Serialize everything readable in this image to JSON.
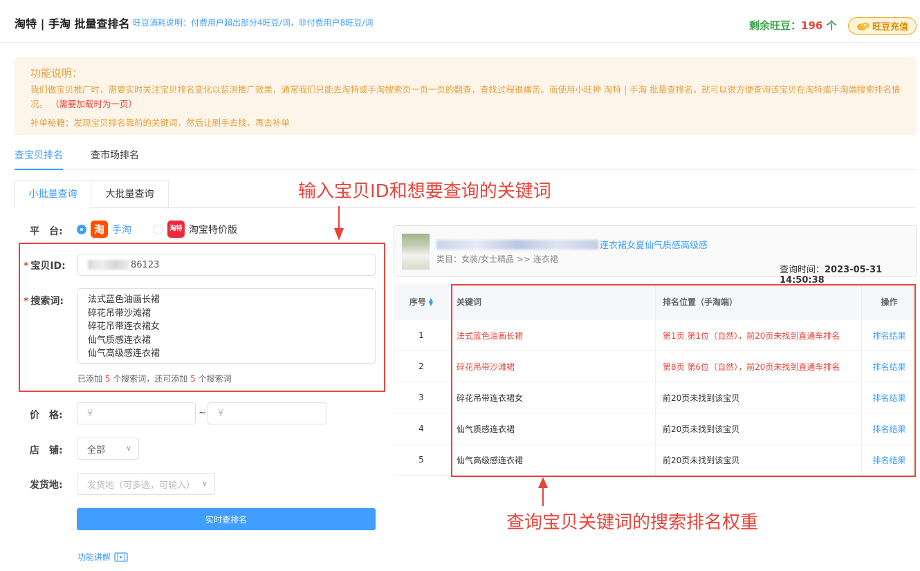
{
  "header": {
    "title": "淘特 | 手淘 批量查排名",
    "consume_note": "旺豆消耗说明：付费用户超出部分4旺豆/词，非付费用户8旺豆/词",
    "balance_label": "剩余旺豆：",
    "balance_value": "196",
    "balance_unit": " 个",
    "recharge_label": "旺豆充值"
  },
  "notice": {
    "title": "功能说明：",
    "body": "我们做宝贝推广时，需要实时关注宝贝排名变化以监测推广效果，通常我们只能去淘特或手淘搜索页一页一页的翻查，查找过程很痛苦。而使用小旺神 淘特 | 手淘 批量查排名，就可以很方便查询该宝贝在淘特或手淘端搜索排名情况。",
    "body_highlight": "（需要加载时为一页）",
    "tip": "补单秘籍：发现宝贝排名靠前的关键词，然后让刷手去找，再去补单"
  },
  "main_tabs": [
    "查宝贝排名",
    "查市场排名"
  ],
  "sub_tabs": [
    "小批量查询",
    "大批量查询"
  ],
  "form": {
    "platform_label": "平　台:",
    "platform_options": [
      "手淘",
      "淘宝特价版"
    ],
    "platform_selected": "手淘",
    "item_id_label": "宝贝ID:",
    "item_id_value": "86123",
    "keywords_label": "搜索词:",
    "keywords": [
      "法式蓝色油画长裙",
      "碎花吊带沙滩裙",
      "碎花吊带连衣裙女",
      "仙气质感连衣裙",
      "仙气高级感连衣裙"
    ],
    "kw_count_prefix": "已添加 ",
    "kw_added": "5",
    "kw_count_mid": " 个搜索词，还可添加 ",
    "kw_remaining": "5",
    "kw_count_suffix": " 个搜索词",
    "price_label": "价　格:",
    "price_min_placeholder": "¥",
    "price_sep": "~",
    "price_max_placeholder": "¥",
    "shop_label": "店　铺:",
    "shop_value": "全部",
    "ship_label": "发货地:",
    "ship_placeholder": "发货地（可多选，可输入）",
    "submit_label": "实时查排名",
    "explain_link": "功能讲解"
  },
  "annotations": {
    "top": "输入宝贝ID和想要查询的关键词",
    "bottom": "查询宝贝关键词的搜索排名权重"
  },
  "product": {
    "title_suffix": "连衣裙女夏仙气质感高级感",
    "category": "类目：女装/女士精品 >> 连衣裙",
    "query_time_label": "查询时间：",
    "query_time": "2023-05-31 14:50:38"
  },
  "table": {
    "headers": [
      "序号",
      "关键词",
      "排名位置（手淘端）",
      "操作"
    ],
    "rows": [
      {
        "idx": "1",
        "keyword": "法式蓝色油画长裙",
        "rank": "第1页 第1位（自然），前20页未找到直通车排名",
        "op": "排名结果",
        "found": true
      },
      {
        "idx": "2",
        "keyword": "碎花吊带沙滩裙",
        "rank": "第8页 第6位（自然），前20页未找到直通车排名",
        "op": "排名结果",
        "found": true
      },
      {
        "idx": "3",
        "keyword": "碎花吊带连衣裙女",
        "rank": "前20页未找到该宝贝",
        "op": "排名结果",
        "found": false
      },
      {
        "idx": "4",
        "keyword": "仙气质感连衣裙",
        "rank": "前20页未找到该宝贝",
        "op": "排名结果",
        "found": false
      },
      {
        "idx": "5",
        "keyword": "仙气高级感连衣裙",
        "rank": "前20页未找到该宝贝",
        "op": "排名结果",
        "found": false
      }
    ]
  },
  "colors": {
    "accent": "#409eff",
    "annotation": "#e9443a",
    "notice_text": "#e6a23c"
  }
}
